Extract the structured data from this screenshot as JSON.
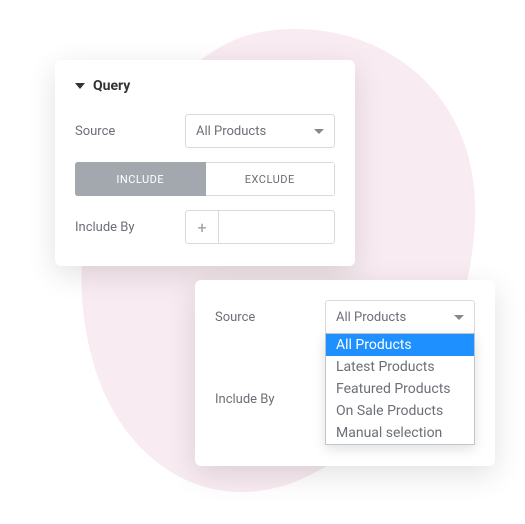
{
  "panel1": {
    "title": "Query",
    "source_label": "Source",
    "source_value": "All Products",
    "toggle": {
      "include": "INCLUDE",
      "exclude": "EXCLUDE"
    },
    "include_by_label": "Include By",
    "add_glyph": "+"
  },
  "panel2": {
    "source_label": "Source",
    "source_value": "All Products",
    "include_by_label": "Include By",
    "options": [
      "All Products",
      "Latest Products",
      "Featured Products",
      "On Sale Products",
      "Manual selection"
    ]
  }
}
